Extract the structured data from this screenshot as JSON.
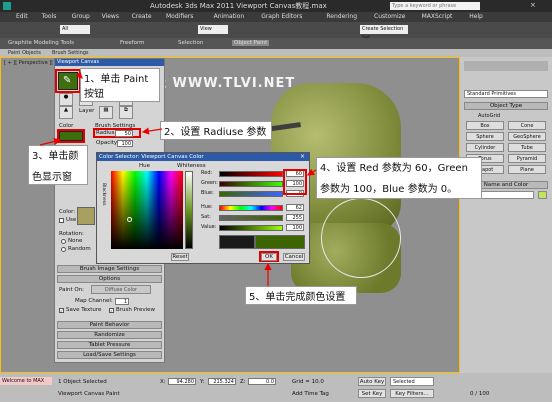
{
  "window": {
    "title": "Autodesk 3ds Max 2011   Viewport Canvas教程.max",
    "search_placeholder": "Type a keyword or phrase"
  },
  "menu": [
    "Edit",
    "Tools",
    "Group",
    "Views",
    "Create",
    "Modifiers",
    "Animation",
    "Graph Editors",
    "Rendering",
    "Customize",
    "MAXScript",
    "Help"
  ],
  "ribbon": {
    "tabs": [
      "Graphite Modeling Tools",
      "Freeform",
      "Selection",
      "Object Paint"
    ],
    "sub_tabs": [
      "Paint Objects",
      "Brush Settings"
    ]
  },
  "toolbar": {
    "filter": "All",
    "view": "View",
    "selection_set": "Create Selection Set"
  },
  "viewport": {
    "label": "[ + ][ Perspective ][ Smooth + Highlights ]",
    "watermark": "教龍視覺 WWW.TLVI.NET"
  },
  "paint_panel": {
    "header": "Viewport Canvas",
    "paint_label": "Paint",
    "layer_label": "Layer",
    "color_label": "Color",
    "color_hex": "#3c6e0e",
    "brush_settings_label": "Brush Settings",
    "radius_label": "Radius:",
    "radius_value": "50",
    "opacity_label": "Opacity:",
    "opacity_value": "100",
    "color_section_label": "Color:",
    "use_label": "Use",
    "rotation_label": "Rotation:",
    "none_label": "None",
    "random_label": "Random",
    "brush_image_settings": "Brush Image Settings",
    "options": "Options",
    "paint_on_label": "Paint On:",
    "paint_on_value": "Diffuse Color",
    "map_channel_label": "Map Channel:",
    "map_channel_value": "1",
    "save_texture": "Save Texture",
    "brush_preview": "Brush Preview",
    "sections": [
      "Paint Behavior",
      "Randomize",
      "Tablet Pressure",
      "Load/Save Settings"
    ]
  },
  "color_dialog": {
    "title": "Color Selector: Viewport Canvas Color",
    "hue_label": "Hue",
    "whiteness_label": "Whiteness",
    "blackness_label": "Blackness",
    "rows": [
      {
        "label": "Red:",
        "value": "60"
      },
      {
        "label": "Green:",
        "value": "100"
      },
      {
        "label": "Blue:",
        "value": "0"
      },
      {
        "label": "Hue:",
        "value": "62"
      },
      {
        "label": "Sat:",
        "value": "255"
      },
      {
        "label": "Value:",
        "value": "100"
      }
    ],
    "reset": "Reset",
    "ok": "OK",
    "cancel": "Cancel"
  },
  "callouts": {
    "step1": "1、单击 Paint 按钮",
    "step2": "2、设置 Radiuse 参数",
    "step3a": "3、单击颜",
    "step3b": "色显示窗",
    "step4a": "4、设置 Red 参数为 60，Green",
    "step4b": "参数为 100，Blue 参数为 0。",
    "step5": "5、单击完成颜色设置"
  },
  "right_panel": {
    "dropdown": "Standard Primitives",
    "object_type": "Object Type",
    "autogrid": "AutoGrid",
    "buttons": [
      "Box",
      "Cone",
      "Sphere",
      "GeoSphere",
      "Cylinder",
      "Tube",
      "Torus",
      "Pyramid",
      "Teapot",
      "Plane"
    ],
    "name_and_color": "Name and Color"
  },
  "status": {
    "selected": "1 Object Selected",
    "hint": "Viewport Canvas Paint",
    "welcome": "Welcome to MAX",
    "x": "94.280",
    "y": "215.324",
    "z": "0.0",
    "grid": "Grid = 10.0",
    "add_time_tag": "Add Time Tag",
    "auto_key": "Auto Key",
    "set_key": "Set Key",
    "key_filters": "Key Filters...",
    "selected_dd": "Selected",
    "frame": "0 / 100"
  }
}
